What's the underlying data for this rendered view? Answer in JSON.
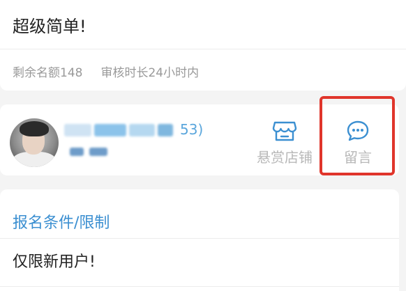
{
  "task": {
    "title": "超级简单!",
    "remaining": "剩余名额148",
    "review_time": "审核时长24小时内"
  },
  "shop": {
    "name_visible_suffix": "53)",
    "actions": [
      {
        "icon": "shop-icon",
        "label": "悬赏店铺"
      },
      {
        "icon": "chat-bubble-icon",
        "label": "留言"
      }
    ]
  },
  "conditions": {
    "title": "报名条件/限制",
    "text": "仅限新用户!"
  },
  "colors": {
    "accent": "#3b8fd1",
    "highlight": "#e0352b",
    "muted": "#999999"
  }
}
